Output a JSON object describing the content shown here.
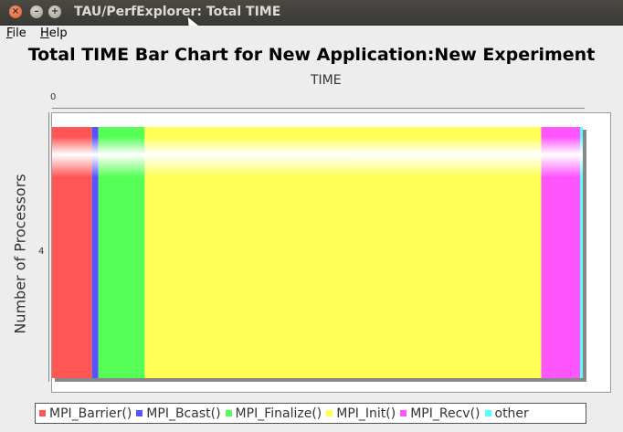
{
  "window": {
    "title": "TAU/PerfExplorer: Total TIME",
    "close_glyph": "×",
    "min_glyph": "–",
    "max_glyph": "+"
  },
  "menu": [
    {
      "label": "File",
      "mnemonic": "F",
      "rest": "ile"
    },
    {
      "label": "Help",
      "mnemonic": "H",
      "rest": "elp"
    }
  ],
  "chart_data": {
    "type": "bar",
    "orientation": "horizontal",
    "stacked": true,
    "title": "Total TIME Bar Chart for New Application:New Experiment",
    "xlabel": "TIME",
    "ylabel": "Number of Processors",
    "x_tick_labels": [
      "0"
    ],
    "categories": [
      "4"
    ],
    "series": [
      {
        "name": "MPI_Barrier()",
        "color": "#ff5555",
        "fraction": 0.075
      },
      {
        "name": "MPI_Bcast()",
        "color": "#5555ff",
        "fraction": 0.012
      },
      {
        "name": "MPI_Finalize()",
        "color": "#55ff55",
        "fraction": 0.087
      },
      {
        "name": "MPI_Init()",
        "color": "#ffff55",
        "fraction": 0.745
      },
      {
        "name": "MPI_Recv()",
        "color": "#ff55ff",
        "fraction": 0.073
      },
      {
        "name": "other",
        "color": "#55ffff",
        "fraction": 0.005
      }
    ],
    "grid": false,
    "legend_position": "bottom"
  }
}
